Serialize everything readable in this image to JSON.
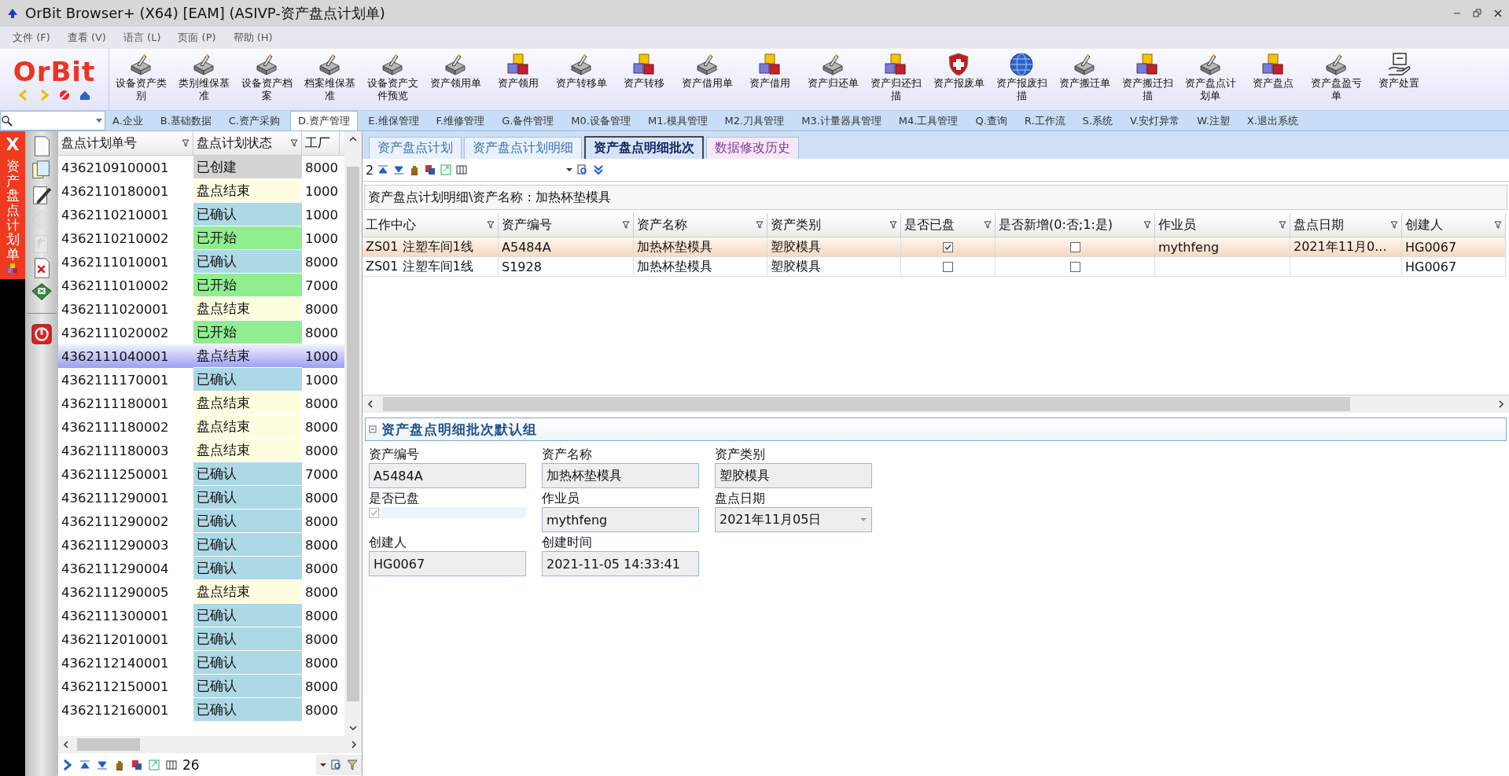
{
  "window": {
    "title": "OrBit Browser+ (X64) [EAM] (ASIVP-资产盘点计划单)"
  },
  "menu": [
    "文件 (F)",
    "查看 (V)",
    "语言 (L)",
    "页面 (P)",
    "帮助 (H)"
  ],
  "logo": "OrBit",
  "toolbar": [
    {
      "label": "设备资产类别",
      "kind": "device"
    },
    {
      "label": "类别维保基准",
      "kind": "device"
    },
    {
      "label": "设备资产档案",
      "kind": "device"
    },
    {
      "label": "档案维保基准",
      "kind": "device"
    },
    {
      "label": "设备资产文件预览",
      "kind": "device"
    },
    {
      "label": "资产领用单",
      "kind": "device"
    },
    {
      "label": "资产领用",
      "kind": "cubes"
    },
    {
      "label": "资产转移单",
      "kind": "device"
    },
    {
      "label": "资产转移",
      "kind": "cubes"
    },
    {
      "label": "资产借用单",
      "kind": "device"
    },
    {
      "label": "资产借用",
      "kind": "cubes"
    },
    {
      "label": "资产归还单",
      "kind": "device"
    },
    {
      "label": "资产归还扫描",
      "kind": "cubes"
    },
    {
      "label": "资产报废单",
      "kind": "shield"
    },
    {
      "label": "资产报废扫描",
      "kind": "globe"
    },
    {
      "label": "资产搬迁单",
      "kind": "device"
    },
    {
      "label": "资产搬迁扫描",
      "kind": "cubes"
    },
    {
      "label": "资产盘点计划单",
      "kind": "device"
    },
    {
      "label": "资产盘点",
      "kind": "cubes"
    },
    {
      "label": "资产盘盈亏单",
      "kind": "device"
    },
    {
      "label": "资产处置",
      "kind": "hand"
    }
  ],
  "nav_tabs": [
    {
      "label": "A.企业",
      "selected": false
    },
    {
      "label": "B.基础数据",
      "selected": false
    },
    {
      "label": "C.资产采购",
      "selected": false
    },
    {
      "label": "D.资产管理",
      "selected": true
    },
    {
      "label": "E.维保管理",
      "selected": false
    },
    {
      "label": "F.维修管理",
      "selected": false
    },
    {
      "label": "G.备件管理",
      "selected": false
    },
    {
      "label": "M0.设备管理",
      "selected": false
    },
    {
      "label": "M1.模具管理",
      "selected": false
    },
    {
      "label": "M2.刀具管理",
      "selected": false
    },
    {
      "label": "M3.计量器具管理",
      "selected": false
    },
    {
      "label": "M4.工具管理",
      "selected": false
    },
    {
      "label": "Q.查询",
      "selected": false
    },
    {
      "label": "R.工作流",
      "selected": false
    },
    {
      "label": "S.系统",
      "selected": false
    },
    {
      "label": "V.安灯异常",
      "selected": false
    },
    {
      "label": "W.注塑",
      "selected": false
    },
    {
      "label": "X.退出系统",
      "selected": false
    }
  ],
  "side_strip": {
    "close": "X",
    "title": "资产盘点计划单"
  },
  "side_tools": [
    {
      "kind": "new",
      "disabled": false
    },
    {
      "kind": "copy",
      "disabled": false
    },
    {
      "kind": "edit",
      "disabled": false
    },
    {
      "kind": "save",
      "disabled": true
    },
    {
      "kind": "undo",
      "disabled": true
    },
    {
      "kind": "delete",
      "disabled": false
    },
    {
      "kind": "excel",
      "disabled": false
    },
    {
      "kind": "power",
      "disabled": false
    }
  ],
  "plan_list": {
    "columns": [
      "盘点计划单号",
      "盘点计划状态",
      "工厂"
    ],
    "rows": [
      {
        "number": "4362109100001",
        "status": "已创建",
        "color": "#d3d3d3",
        "factory": "8000",
        "selected": false
      },
      {
        "number": "4362110180001",
        "status": "盘点结束",
        "color": "#fffde0",
        "factory": "1000",
        "selected": false
      },
      {
        "number": "4362110210001",
        "status": "已确认",
        "color": "#add8e6",
        "factory": "1000",
        "selected": false
      },
      {
        "number": "4362110210002",
        "status": "已开始",
        "color": "#90ee90",
        "factory": "1000",
        "selected": false
      },
      {
        "number": "4362111010001",
        "status": "已确认",
        "color": "#add8e6",
        "factory": "8000",
        "selected": false
      },
      {
        "number": "4362111010002",
        "status": "已开始",
        "color": "#90ee90",
        "factory": "7000",
        "selected": false
      },
      {
        "number": "4362111020001",
        "status": "盘点结束",
        "color": "#fffde0",
        "factory": "8000",
        "selected": false
      },
      {
        "number": "4362111020002",
        "status": "已开始",
        "color": "#90ee90",
        "factory": "8000",
        "selected": false
      },
      {
        "number": "4362111040001",
        "status": "盘点结束",
        "factory": "1000",
        "selected": true
      },
      {
        "number": "4362111170001",
        "status": "已确认",
        "color": "#add8e6",
        "factory": "1000",
        "selected": false
      },
      {
        "number": "4362111180001",
        "status": "盘点结束",
        "color": "#fffde0",
        "factory": "8000",
        "selected": false
      },
      {
        "number": "4362111180002",
        "status": "盘点结束",
        "color": "#fffde0",
        "factory": "8000",
        "selected": false
      },
      {
        "number": "4362111180003",
        "status": "盘点结束",
        "color": "#fffde0",
        "factory": "8000",
        "selected": false
      },
      {
        "number": "4362111250001",
        "status": "已确认",
        "color": "#add8e6",
        "factory": "7000",
        "selected": false
      },
      {
        "number": "4362111290001",
        "status": "已确认",
        "color": "#add8e6",
        "factory": "8000",
        "selected": false
      },
      {
        "number": "4362111290002",
        "status": "已确认",
        "color": "#add8e6",
        "factory": "8000",
        "selected": false
      },
      {
        "number": "4362111290003",
        "status": "已确认",
        "color": "#add8e6",
        "factory": "8000",
        "selected": false
      },
      {
        "number": "4362111290004",
        "status": "已确认",
        "color": "#add8e6",
        "factory": "8000",
        "selected": false
      },
      {
        "number": "4362111290005",
        "status": "盘点结束",
        "color": "#fffde0",
        "factory": "8000",
        "selected": false
      },
      {
        "number": "4362111300001",
        "status": "已确认",
        "color": "#add8e6",
        "factory": "8000",
        "selected": false
      },
      {
        "number": "4362112010001",
        "status": "已确认",
        "color": "#add8e6",
        "factory": "8000",
        "selected": false
      },
      {
        "number": "4362112140001",
        "status": "已确认",
        "color": "#add8e6",
        "factory": "8000",
        "selected": false
      },
      {
        "number": "4362112150001",
        "status": "已确认",
        "color": "#add8e6",
        "factory": "8000",
        "selected": false
      },
      {
        "number": "4362112160001",
        "status": "已确认",
        "color": "#add8e6",
        "factory": "8000",
        "selected": false
      }
    ],
    "record_count": "26"
  },
  "detail_tabs": [
    {
      "label": "资产盘点计划",
      "selected": false
    },
    {
      "label": "资产盘点计划明细",
      "selected": false
    },
    {
      "label": "资产盘点明细批次",
      "selected": true
    },
    {
      "label": "数据修改历史",
      "selected": false
    }
  ],
  "detail_toolbar": {
    "count": "2"
  },
  "breadcrumb": "资产盘点计划明细\\资产名称 : 加热杯垫模具",
  "grid": {
    "columns": [
      "工作中心",
      "资产编号",
      "资产名称",
      "资产类别",
      "是否已盘",
      "是否新增(0:否;1:是)",
      "作业员",
      "盘点日期",
      "创建人"
    ],
    "rows": [
      {
        "selected": true,
        "work_center": "ZS01 注塑车间1线",
        "asset_no": "A5484A",
        "asset_name": "加热杯垫模具",
        "asset_type": "塑胶模具",
        "counted": true,
        "is_new": false,
        "operator": "mythfeng",
        "count_date": "2021年11月0...",
        "creator": "HG0067"
      },
      {
        "selected": false,
        "work_center": "ZS01 注塑车间1线",
        "asset_no": "S1928",
        "asset_name": "加热杯垫模具",
        "asset_type": "塑胶模具",
        "counted": false,
        "is_new": false,
        "creator": "HG0067"
      }
    ]
  },
  "form": {
    "title": "资产盘点明细批次默认组",
    "fields": [
      {
        "label": "资产编号",
        "kind": "text",
        "value": "A5484A"
      },
      {
        "label": "资产名称",
        "kind": "text",
        "value": "加热杯垫模具"
      },
      {
        "label": "资产类别",
        "kind": "text",
        "value": "塑胶模具"
      },
      {
        "label": "是否已盘",
        "kind": "checkbox",
        "checked": true
      },
      {
        "label": "作业员",
        "kind": "text",
        "value": "mythfeng"
      },
      {
        "label": "盘点日期",
        "kind": "date",
        "value": "2021年11月05日"
      },
      {
        "label": "创建人",
        "kind": "text",
        "value": "HG0067"
      },
      {
        "label": "创建时间",
        "kind": "text",
        "value": "2021-11-05 14:33:41"
      }
    ]
  }
}
